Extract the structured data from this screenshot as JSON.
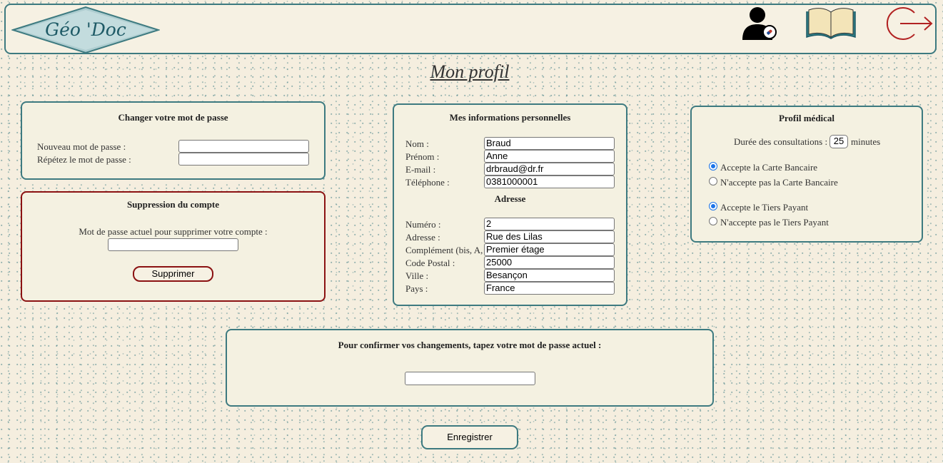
{
  "header": {
    "logo_text": "Géo 'Doc",
    "icons": [
      "doctor-profile-icon",
      "book-icon",
      "logout-icon"
    ]
  },
  "page_title": "Mon profil",
  "password_card": {
    "title": "Changer votre mot de passe",
    "new_password_label": "Nouveau mot de passe :",
    "repeat_password_label": "Répétez le mot de passe :",
    "new_password_value": "",
    "repeat_password_value": ""
  },
  "delete_card": {
    "title": "Suppression du compte",
    "prompt": "Mot de passe actuel pour supprimer votre compte :",
    "password_value": "",
    "button_label": "Supprimer"
  },
  "personal_card": {
    "title": "Mes informations personnelles",
    "fields": [
      {
        "label": "Nom :",
        "value": "Braud"
      },
      {
        "label": "Prénom :",
        "value": "Anne"
      },
      {
        "label": "E-mail :",
        "value": "drbraud@dr.fr"
      },
      {
        "label": "Téléphone :",
        "value": "0381000001"
      }
    ],
    "address_title": "Adresse",
    "address_fields": [
      {
        "label": "Numéro :",
        "value": "2"
      },
      {
        "label": "Adresse :",
        "value": "Rue des Lilas"
      },
      {
        "label": "Complément (bis, A, ...) :",
        "value": "Premier étage"
      },
      {
        "label": "Code Postal :",
        "value": "25000"
      },
      {
        "label": "Ville :",
        "value": "Besançon"
      },
      {
        "label": "Pays :",
        "value": "France"
      }
    ]
  },
  "medical_card": {
    "title": "Profil médical",
    "duration_label": "Durée des consultations :",
    "duration_value": "25",
    "duration_unit": "minutes",
    "card_options": [
      {
        "label": "Accepte la Carte Bancaire",
        "checked": true
      },
      {
        "label": "N'accepte pas la Carte Bancaire",
        "checked": false
      }
    ],
    "tiers_options": [
      {
        "label": "Accepte le Tiers Payant",
        "checked": true
      },
      {
        "label": "N'accepte pas le Tiers Payant",
        "checked": false
      }
    ]
  },
  "confirm_card": {
    "prompt": "Pour confirmer vos changements, tapez votre mot de passe actuel :",
    "password_value": ""
  },
  "save_button_label": "Enregistrer",
  "colors": {
    "border": "#3d7a80",
    "danger": "#8b1212",
    "background": "#f5eedf",
    "radio": "#1a73e8",
    "logout": "#b22222"
  }
}
